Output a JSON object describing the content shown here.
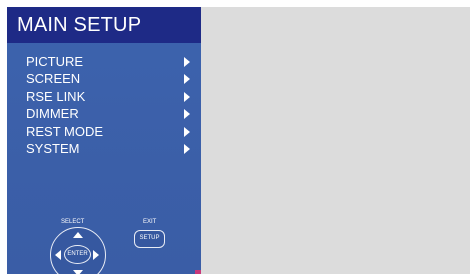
{
  "menu": {
    "title": "MAIN SETUP",
    "items": [
      {
        "label": "PICTURE",
        "icon": "chevron-right-icon"
      },
      {
        "label": "SCREEN",
        "icon": "chevron-right-icon"
      },
      {
        "label": "RSE LINK",
        "icon": "chevron-right-icon"
      },
      {
        "label": "DIMMER",
        "icon": "chevron-right-icon"
      },
      {
        "label": "REST MODE",
        "icon": "chevron-right-icon"
      },
      {
        "label": "SYSTEM",
        "icon": "chevron-right-icon"
      }
    ]
  },
  "controls": {
    "select_label": "SELECT",
    "exit_label": "EXIT",
    "enter_label": "ENTER",
    "setup_label": "SETUP"
  },
  "colors": {
    "header_bg": "#1e2a86",
    "panel_bg": "#3d63ae",
    "right_area_bg": "#dcdcdc",
    "text": "#ffffff"
  }
}
